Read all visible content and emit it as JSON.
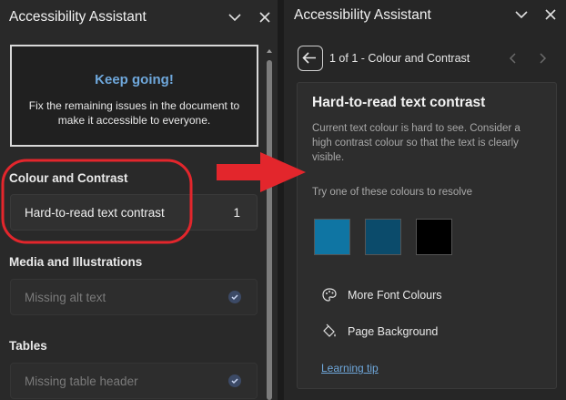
{
  "left": {
    "title": "Accessibility Assistant",
    "keep": {
      "title": "Keep going!",
      "text": "Fix the remaining issues in the document to make it accessible to everyone."
    },
    "sections": [
      {
        "heading": "Colour and Contrast",
        "item": "Hard-to-read text contrast",
        "count": "1"
      },
      {
        "heading": "Media and Illustrations",
        "item": "Missing alt text"
      },
      {
        "heading": "Tables",
        "item": "Missing table header"
      }
    ]
  },
  "right": {
    "title": "Accessibility Assistant",
    "nav": "1 of 1 - Colour and Contrast",
    "card": {
      "title": "Hard-to-read text contrast",
      "desc": "Current text colour is hard to see. Consider a high contrast colour so that the text is clearly visible.",
      "try": "Try one of these colours to resolve",
      "swatches": [
        "#0f75a3",
        "#0b4b6b",
        "#000000"
      ],
      "actions": [
        "More Font Colours",
        "Page Background"
      ],
      "tip": "Learning tip"
    }
  },
  "colors": {
    "accent": "#6fa8dc",
    "annotation": "#e3262c"
  }
}
